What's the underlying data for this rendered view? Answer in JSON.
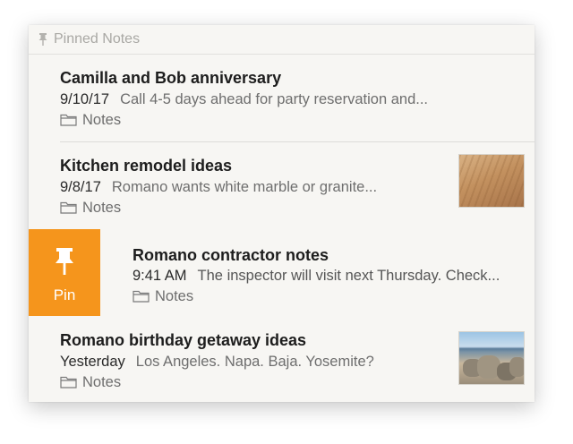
{
  "section": {
    "label": "Pinned Notes",
    "icon": "pin-icon"
  },
  "notes": [
    {
      "title": "Camilla and Bob anniversary",
      "date": "9/10/17",
      "preview": "Call 4-5 days ahead for party reservation and...",
      "folder": "Notes"
    },
    {
      "title": "Kitchen remodel ideas",
      "date": "9/8/17",
      "preview": "Romano wants white marble or granite...",
      "folder": "Notes",
      "thumbnail": "wood-floor-photo"
    },
    {
      "title": "Romano contractor notes",
      "date": "9:41 AM",
      "preview": "The inspector will visit next Thursday. Check...",
      "folder": "Notes"
    },
    {
      "title": "Romano birthday getaway ideas",
      "date": "Yesterday",
      "preview": "Los Angeles. Napa. Baja. Yosemite?",
      "folder": "Notes",
      "thumbnail": "beach-rocks-photo"
    }
  ],
  "swipe_action": {
    "label": "Pin",
    "icon": "pin-icon",
    "color": "#f5951c"
  },
  "colors": {
    "highlight": "#f9df96",
    "background": "#f7f6f3"
  }
}
